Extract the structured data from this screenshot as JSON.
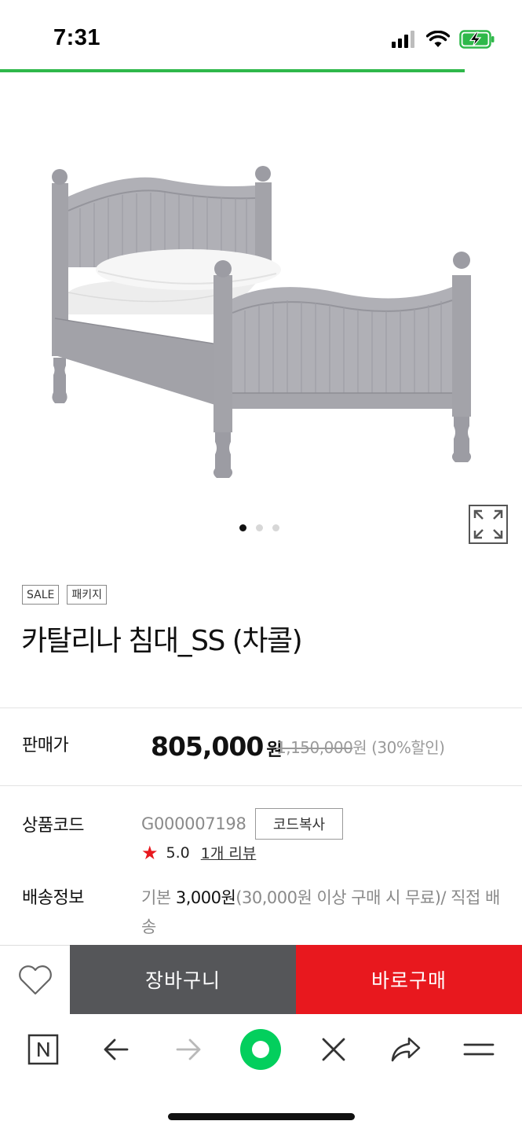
{
  "status_bar": {
    "time": "7:31"
  },
  "product": {
    "badges": [
      "SALE",
      "패키지"
    ],
    "title": "카탈리나 침대_SS (차콜)",
    "image_count": 3,
    "active_image": 1
  },
  "price": {
    "label": "판매가",
    "sale_price": "805,000",
    "unit": "원",
    "original_price": "1,150,000",
    "original_unit": "원",
    "discount": "(30%할인)"
  },
  "code": {
    "label": "상품코드",
    "value": "G000007198",
    "copy_button": "코드복사"
  },
  "rating": {
    "score": "5.0",
    "review_link": "1개 리뷰"
  },
  "shipping": {
    "label": "배송정보",
    "prefix": "기본",
    "fee": "3,000원",
    "detail": "(30,000원 이상 구매 시 무료)/ 직접 배송"
  },
  "actions": {
    "cart": "장바구니",
    "buy": "바로구매"
  },
  "colors": {
    "accent_green": "#2fb84a",
    "buy_red": "#e8181e",
    "cart_gray": "#555659",
    "naver_green": "#03cf5d"
  },
  "icons": {
    "wishlist": "heart-icon",
    "expand": "expand-icon",
    "naver": "naver-n-icon",
    "back": "arrow-left-icon",
    "forward": "arrow-right-icon",
    "green_dot": "naver-green-dot-icon",
    "close": "close-icon",
    "share": "share-icon",
    "menu": "menu-icon"
  }
}
